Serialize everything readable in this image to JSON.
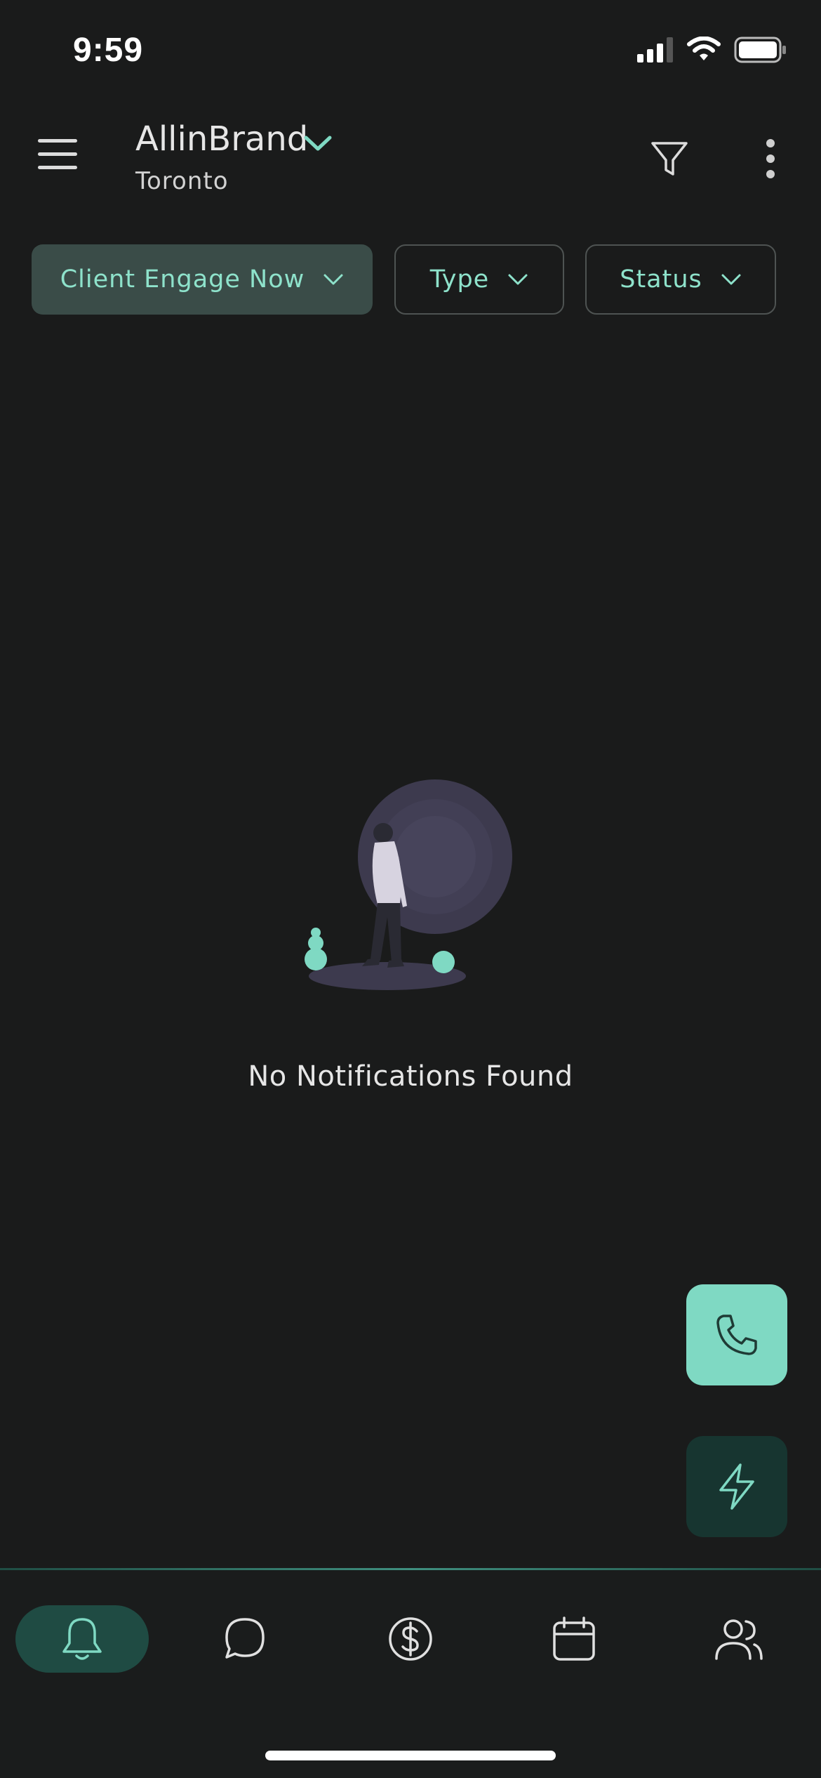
{
  "status_bar": {
    "time": "9:59"
  },
  "header": {
    "brand": "AllinBrand",
    "location": "Toronto"
  },
  "filters": {
    "primary": "Client Engage Now",
    "type": "Type",
    "status": "Status"
  },
  "empty_state": {
    "message": "No Notifications Found"
  },
  "fabs": [
    {
      "icon": "phone-icon"
    },
    {
      "icon": "lightning-icon"
    }
  ],
  "bottom_nav": [
    {
      "icon": "bell-icon",
      "active": true
    },
    {
      "icon": "chat-bubble-icon",
      "active": false
    },
    {
      "icon": "dollar-circle-icon",
      "active": false
    },
    {
      "icon": "calendar-icon",
      "active": false
    },
    {
      "icon": "users-icon",
      "active": false
    }
  ],
  "colors": {
    "background": "#1a1b1b",
    "accent": "#7fd9c3",
    "accent_text": "#8ee2cb",
    "chip_active_bg": "#3a4c48",
    "nav_active_bg": "#1f4b43",
    "fab_dark_bg": "#173530",
    "illustration_purple": "#3d3a4e"
  }
}
